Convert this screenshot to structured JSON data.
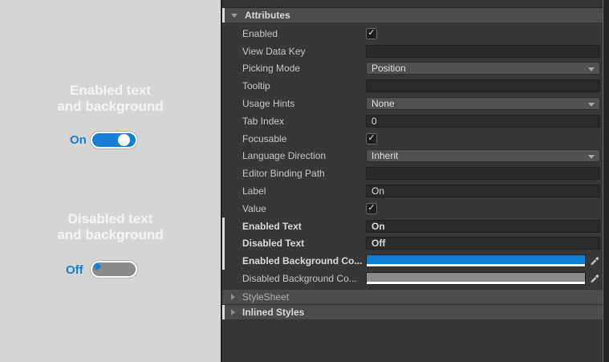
{
  "preview": {
    "enabled_caption_line1": "Enabled text",
    "enabled_caption_line2": "and background",
    "enabled_toggle_label": "On",
    "disabled_caption_line1": "Disabled text",
    "disabled_caption_line2": "and background",
    "disabled_toggle_label": "Off",
    "enabled_toggle_state": "on",
    "disabled_toggle_state": "off"
  },
  "inspector": {
    "sections": [
      {
        "label": "Attributes",
        "expanded": true,
        "bold": true,
        "overridden": true
      },
      {
        "label": "StyleSheet",
        "expanded": false,
        "bold": false,
        "overridden": false
      },
      {
        "label": "Inlined Styles",
        "expanded": false,
        "bold": true,
        "overridden": true
      }
    ],
    "attributes_rows": [
      {
        "label": "Enabled",
        "type": "checkbox",
        "checked": true
      },
      {
        "label": "View Data Key",
        "type": "text",
        "value": ""
      },
      {
        "label": "Picking Mode",
        "type": "dropdown",
        "value": "Position"
      },
      {
        "label": "Tooltip",
        "type": "text",
        "value": ""
      },
      {
        "label": "Usage Hints",
        "type": "dropdown",
        "value": "None"
      },
      {
        "label": "Tab Index",
        "type": "text",
        "value": "0"
      },
      {
        "label": "Focusable",
        "type": "checkbox",
        "checked": true
      },
      {
        "label": "Language Direction",
        "type": "dropdown",
        "value": "Inherit"
      },
      {
        "label": "Editor Binding Path",
        "type": "text",
        "value": ""
      },
      {
        "label": "Label",
        "type": "text",
        "value": "On"
      },
      {
        "label": "Value",
        "type": "checkbox",
        "checked": true
      },
      {
        "label": "Enabled Text",
        "type": "text",
        "value": "On",
        "bold": true,
        "value_bold": true,
        "overridden": true
      },
      {
        "label": "Disabled Text",
        "type": "text",
        "value": "Off",
        "bold": true,
        "value_bold": true,
        "overridden": true
      },
      {
        "label": "Enabled Background Co...",
        "type": "color",
        "color": "#0e7ed8",
        "bold": true,
        "overridden": true
      },
      {
        "label": "Disabled Background Co...",
        "type": "color",
        "color": "#8b8b8b",
        "bold": false
      }
    ],
    "icons": {
      "checkbox_check": "✓",
      "eyedropper": "eyedropper-icon",
      "foldout_expanded": "triangle-down-icon",
      "foldout_collapsed": "triangle-right-icon",
      "dropdown_arrow": "triangle-down-icon"
    }
  },
  "colors": {
    "preview_background": "#d5d5d5",
    "caption_text": "#f3f3f3",
    "accent_blue": "#1780d6",
    "toggle_off_fill": "#8b8b8b",
    "inspector_background": "#373737",
    "header_background": "#4c4c4c",
    "field_background": "#2a2a2a",
    "dropdown_background": "#515151",
    "label_text": "#c6c6c6",
    "value_text": "#d8d8d8",
    "override_bar": "#dcdcdc",
    "enabled_background_color_value": "#0e7ed8",
    "disabled_background_color_value": "#8b8b8b"
  }
}
